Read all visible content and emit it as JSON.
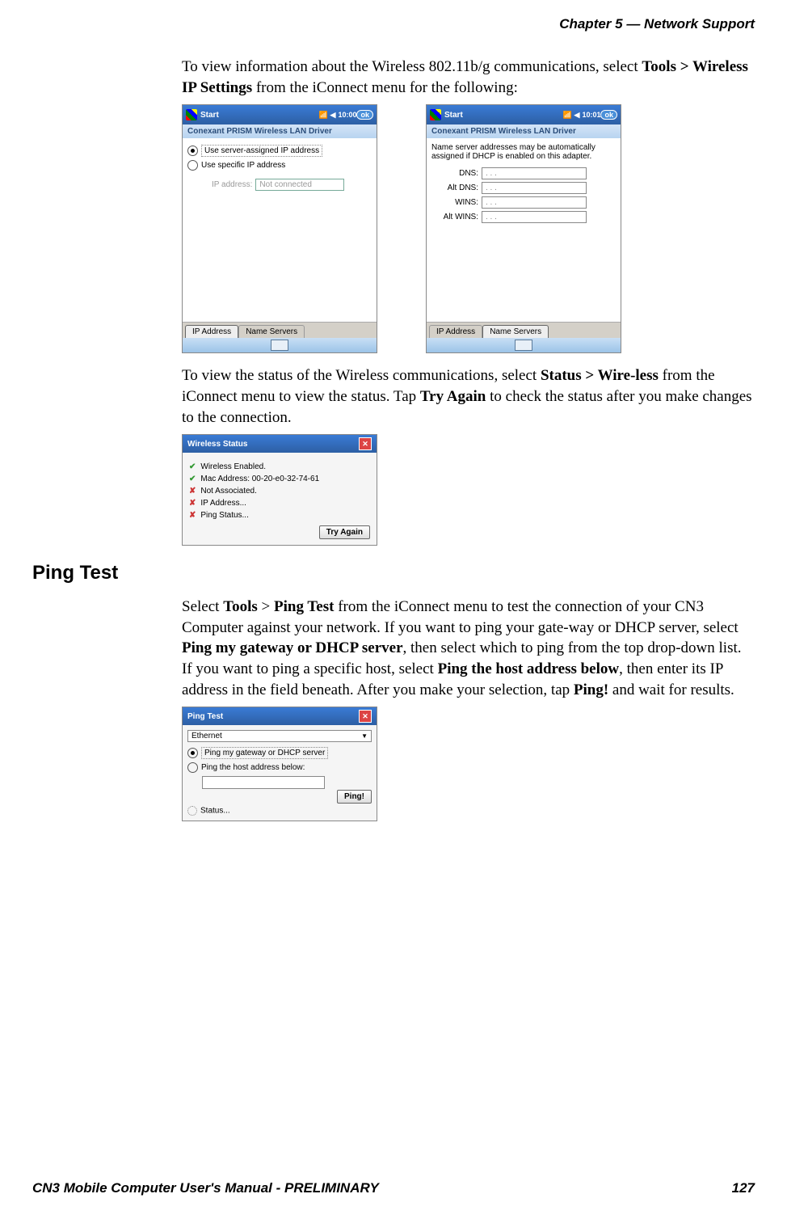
{
  "header": "Chapter 5 —  Network Support",
  "para1": {
    "text": "To view information about the Wireless 802.11b/g communications, select ",
    "bold1": "Tools > Wireless IP Settings",
    "rest": " from the iConnect menu for the following:"
  },
  "screen1": {
    "start": "Start",
    "time": "10:00",
    "ok": "ok",
    "subtitle": "Conexant PRISM Wireless LAN Driver",
    "radio1": "Use server-assigned IP address",
    "radio2": "Use specific IP address",
    "ipLabel": "IP address:",
    "ipValue": "Not connected",
    "tab1": "IP Address",
    "tab2": "Name Servers"
  },
  "screen2": {
    "start": "Start",
    "time": "10:01",
    "ok": "ok",
    "subtitle": "Conexant PRISM Wireless LAN Driver",
    "note": "Name server addresses may be automatically assigned if DHCP is enabled on this adapter.",
    "dns": "DNS:",
    "altdns": "Alt DNS:",
    "wins": "WINS:",
    "altwins": "Alt WINS:",
    "dots": ".       .       .",
    "tab1": "IP Address",
    "tab2": "Name Servers"
  },
  "para2": {
    "p1": "To view the status of the Wireless communications, select ",
    "b1": "Status > Wire-less",
    "p2": " from the iConnect menu to view the status. Tap ",
    "b2": "Try Again",
    "p3": " to check the status after you make changes to the connection."
  },
  "status": {
    "title": "Wireless Status",
    "r1": "Wireless Enabled.",
    "r2": "Mac Address: 00-20-e0-32-74-61",
    "r3": "Not Associated.",
    "r4": "IP Address...",
    "r5": "Ping Status...",
    "btn": "Try Again"
  },
  "heading": "Ping Test",
  "para3": {
    "p1": "Select ",
    "b1": "Tools",
    "p2": " > ",
    "b2": "Ping Test",
    "p3": " from the iConnect menu to test the connection of your CN3 Computer against your network. If you want to ping your gate-way or DHCP server, select ",
    "b3": "Ping my gateway or DHCP server",
    "p4": ", then select which to ping from the top drop-down list. If you want to ping a specific host, select ",
    "b4": "Ping the host address below",
    "p5": ", then enter its IP address in the field beneath. After you make your selection, tap ",
    "b5": "Ping!",
    "p6": " and wait for results."
  },
  "ping": {
    "title": "Ping Test",
    "dropdown": "Ethernet",
    "radio1": "Ping my gateway or DHCP server",
    "radio2": "Ping the host address below:",
    "btn": "Ping!",
    "status": "Status..."
  },
  "footer": {
    "left": "CN3 Mobile Computer User's Manual - PRELIMINARY",
    "right": "127"
  }
}
